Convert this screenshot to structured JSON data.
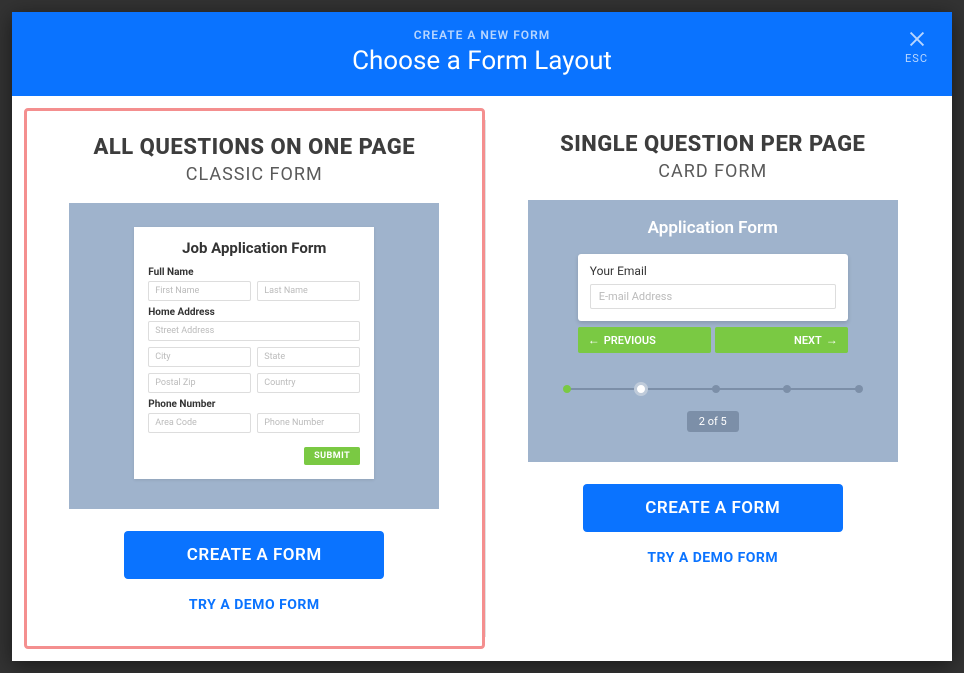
{
  "header": {
    "subtitle": "CREATE A NEW FORM",
    "title": "Choose a Form Layout",
    "close_label": "ESC"
  },
  "left": {
    "title": "ALL QUESTIONS ON ONE PAGE",
    "subtitle": "CLASSIC FORM",
    "preview": {
      "form_title": "Job Application Form",
      "sections": {
        "full_name": {
          "label": "Full Name",
          "first_ph": "First Name",
          "last_ph": "Last Name"
        },
        "address": {
          "label": "Home Address",
          "street_ph": "Street Address",
          "city_ph": "City",
          "state_ph": "State",
          "postal_ph": "Postal Zip",
          "country_ph": "Country"
        },
        "phone": {
          "label": "Phone Number",
          "area_ph": "Area Code",
          "num_ph": "Phone Number"
        }
      },
      "submit": "SUBMIT"
    },
    "create_button": "CREATE A FORM",
    "demo_link": "TRY A DEMO FORM"
  },
  "right": {
    "title": "SINGLE QUESTION PER PAGE",
    "subtitle": "CARD FORM",
    "preview": {
      "form_title": "Application Form",
      "card_label": "Your Email",
      "card_ph": "E-mail Address",
      "prev": "PREVIOUS",
      "next": "NEXT",
      "step": "2 of 5"
    },
    "create_button": "CREATE A FORM",
    "demo_link": "TRY A DEMO FORM"
  }
}
